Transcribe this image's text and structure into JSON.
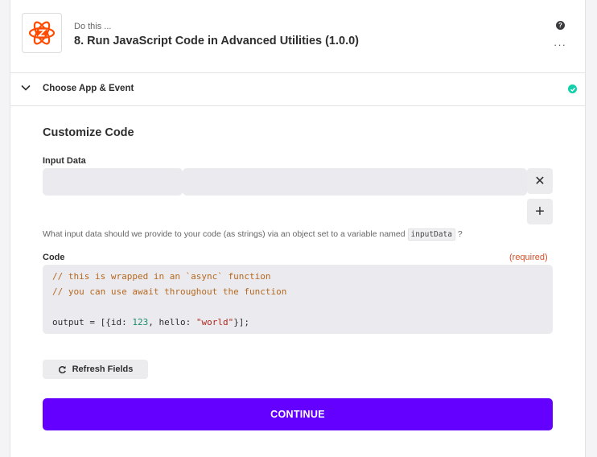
{
  "header": {
    "app_icon": "code-by-zapier-atom-icon",
    "subtitle": "Do this ...",
    "title": "8. Run JavaScript Code in Advanced Utilities (1.0.0)",
    "help_glyph": "?",
    "more_glyph": "···"
  },
  "section": {
    "label": "Choose App & Event",
    "status": "complete"
  },
  "form": {
    "heading": "Customize Code",
    "input_data_label": "Input Data",
    "input_key_value": "",
    "input_value_value": "",
    "remove_glyph": "✕",
    "add_glyph": "+",
    "help_text_prefix": "What input data should we provide to your code (as strings) via an object set to a variable named",
    "help_text_code": "inputData",
    "help_text_suffix": "?",
    "code_label": "Code",
    "required_label": "(required)",
    "code_line1": "// this is wrapped in an `async` function",
    "code_line2": "// you can use await throughout the function",
    "code_line4_a": "output = [{id: ",
    "code_line4_num": "123",
    "code_line4_b": ", hello: ",
    "code_line4_str": "\"world\"",
    "code_line4_c": "}];",
    "refresh_label": "Refresh Fields",
    "continue_label": "CONTINUE"
  },
  "colors": {
    "accent": "#6300ff",
    "success": "#13d0ab",
    "required": "#d94f2a",
    "brand_zapier": "#ff4a00"
  }
}
